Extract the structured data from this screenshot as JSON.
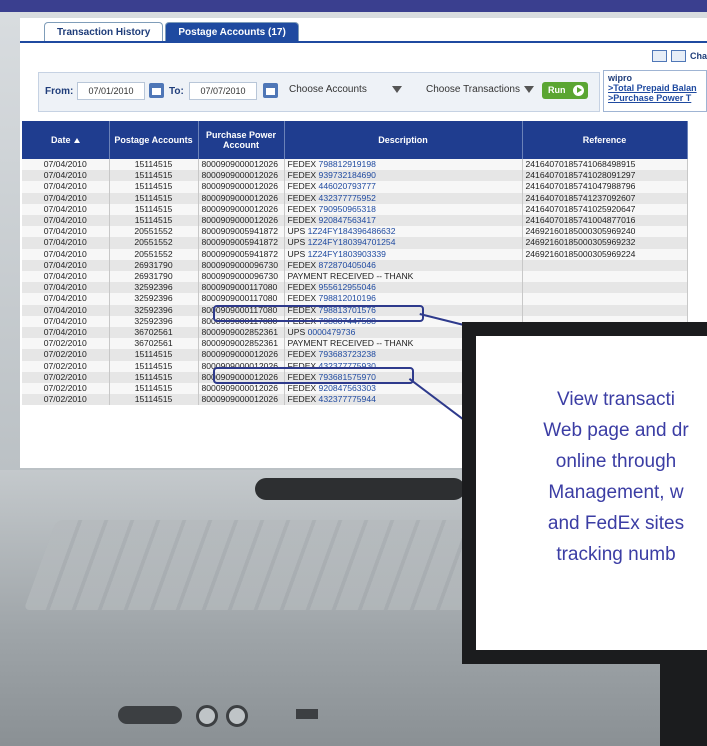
{
  "tabs": [
    {
      "label": "Transaction History"
    },
    {
      "label": "Postage Accounts  (17)"
    }
  ],
  "toolbar": {
    "chart_label": "Cha"
  },
  "filter": {
    "from_label": "From:",
    "from_date": "07/01/2010",
    "to_label": "To:",
    "to_date": "07/07/2010",
    "accounts_select": "Choose Accounts",
    "transactions_select": "Choose Transactions",
    "run_label": "Run"
  },
  "side_panel": {
    "org": "wipro",
    "link1": ">Total Prepaid Balan",
    "link2": ">Purchase Power T"
  },
  "table": {
    "headers": [
      "Date",
      "Postage Accounts",
      "Purchase Power Account",
      "Description",
      "Reference"
    ],
    "rows": [
      {
        "date": "07/04/2010",
        "acct": "15114515",
        "pp": "8000909000012026",
        "carrier": "FEDEX",
        "track": "798812919198",
        "ref": "24164070185741068498915"
      },
      {
        "date": "07/04/2010",
        "acct": "15114515",
        "pp": "8000909000012026",
        "carrier": "FEDEX",
        "track": "939732184690",
        "ref": "24164070185741028091297"
      },
      {
        "date": "07/04/2010",
        "acct": "15114515",
        "pp": "8000909000012026",
        "carrier": "FEDEX",
        "track": "446020793777",
        "ref": "24164070185741047988796"
      },
      {
        "date": "07/04/2010",
        "acct": "15114515",
        "pp": "8000909000012026",
        "carrier": "FEDEX",
        "track": "432377775952",
        "ref": "24164070185741237092607"
      },
      {
        "date": "07/04/2010",
        "acct": "15114515",
        "pp": "8000909000012026",
        "carrier": "FEDEX",
        "track": "790950965318",
        "ref": "24164070185741025920647"
      },
      {
        "date": "07/04/2010",
        "acct": "15114515",
        "pp": "8000909000012026",
        "carrier": "FEDEX",
        "track": "920847563417",
        "ref": "24164070185741004877016"
      },
      {
        "date": "07/04/2010",
        "acct": "20551552",
        "pp": "8000909005941872",
        "carrier": "UPS",
        "track": "1Z24FY184396486632",
        "ref": "24692160185000305969240"
      },
      {
        "date": "07/04/2010",
        "acct": "20551552",
        "pp": "8000909005941872",
        "carrier": "UPS",
        "track": "1Z24FY180394701254",
        "ref": "24692160185000305969232"
      },
      {
        "date": "07/04/2010",
        "acct": "20551552",
        "pp": "8000909005941872",
        "carrier": "UPS",
        "track": "1Z24FY1803903339",
        "ref": "24692160185000305969224"
      },
      {
        "date": "07/04/2010",
        "acct": "26931790",
        "pp": "8000909000096730",
        "carrier": "FEDEX",
        "track": "872870405046",
        "ref": ""
      },
      {
        "date": "07/04/2010",
        "acct": "26931790",
        "pp": "8000909000096730",
        "carrier": "PAYMENT RECEIVED -- THANK",
        "track": "",
        "ref": ""
      },
      {
        "date": "07/04/2010",
        "acct": "32592396",
        "pp": "8000909000117080",
        "carrier": "FEDEX",
        "track": "955612955046",
        "ref": ""
      },
      {
        "date": "07/04/2010",
        "acct": "32592396",
        "pp": "8000909000117080",
        "carrier": "FEDEX",
        "track": "798812010196",
        "ref": ""
      },
      {
        "date": "07/04/2010",
        "acct": "32592396",
        "pp": "8000909000117080",
        "carrier": "FEDEX",
        "track": "798813701576",
        "ref": ""
      },
      {
        "date": "07/04/2010",
        "acct": "32592396",
        "pp": "8000909000117080",
        "carrier": "FEDEX",
        "track": "798807447508",
        "ref": ""
      },
      {
        "date": "07/04/2010",
        "acct": "36702561",
        "pp": "8000909002852361",
        "carrier": "UPS",
        "track": "0000479736",
        "ref": ""
      },
      {
        "date": "07/02/2010",
        "acct": "36702561",
        "pp": "8000909002852361",
        "carrier": "PAYMENT RECEIVED -- THANK",
        "track": "",
        "ref": ""
      },
      {
        "date": "07/02/2010",
        "acct": "15114515",
        "pp": "8000909000012026",
        "carrier": "FEDEX",
        "track": "793683723238",
        "ref": ""
      },
      {
        "date": "07/02/2010",
        "acct": "15114515",
        "pp": "8000909000012026",
        "carrier": "FEDEX",
        "track": "432377775930",
        "ref": ""
      },
      {
        "date": "07/02/2010",
        "acct": "15114515",
        "pp": "8000909000012026",
        "carrier": "FEDEX",
        "track": "793681575970",
        "ref": ""
      },
      {
        "date": "07/02/2010",
        "acct": "15114515",
        "pp": "8000909000012026",
        "carrier": "FEDEX",
        "track": "920847563303",
        "ref": ""
      },
      {
        "date": "07/02/2010",
        "acct": "15114515",
        "pp": "8000909000012026",
        "carrier": "FEDEX",
        "track": "432377775944",
        "ref": ""
      }
    ]
  },
  "callout": {
    "lines": [
      "View transacti",
      "Web page and dr",
      "online through",
      "Management, w",
      "and FedEx sites",
      "tracking numb"
    ]
  },
  "colors": {
    "accent": "#1f3d8f",
    "callout_text": "#3b3da4",
    "run_button": "#5aa532"
  }
}
